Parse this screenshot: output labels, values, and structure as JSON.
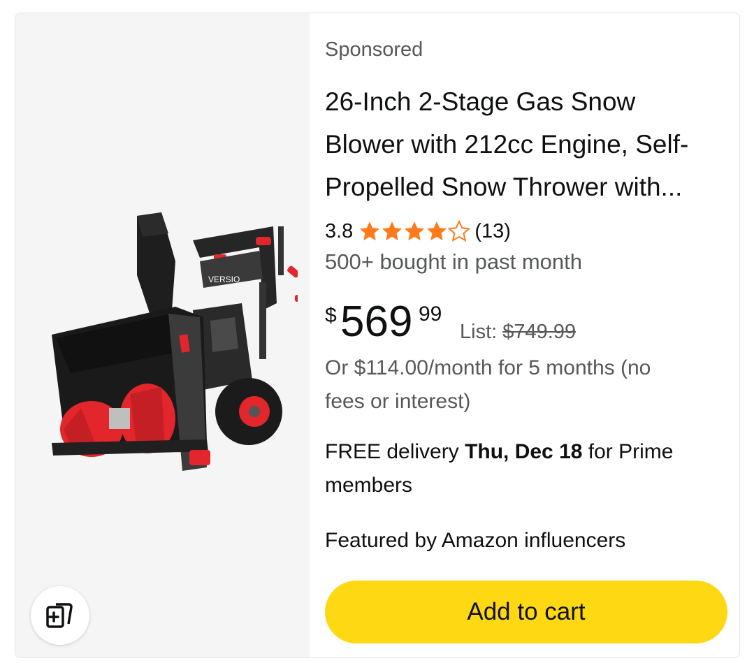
{
  "product": {
    "sponsored_label": "Sponsored",
    "title_line1": "26-Inch 2-Stage Gas Snow",
    "title_line2": "Blower with 212cc Engine, Self-",
    "title_line3": "Propelled Snow Thrower with...",
    "rating": "3.8",
    "rating_value": 3.8,
    "star_count": 5,
    "filled_stars": 4,
    "review_count": "(13)",
    "bought": "500+ bought in past month",
    "price_symbol": "$",
    "price_whole": "569",
    "price_fraction": "99",
    "list_label": "List: ",
    "list_price": "$749.99",
    "installment_line1": "Or $114.00/month for 5 months (no",
    "installment_line2": "fees or interest)",
    "delivery_prefix": "FREE delivery ",
    "delivery_date": "Thu, Dec 18",
    "delivery_suffix": " for Prime",
    "delivery_line2": "members",
    "featured": "Featured by Amazon influencers",
    "image_icon": "snow-blower-product-image",
    "image_brand_text": "VERSIO"
  },
  "actions": {
    "add_to_cart": "Add to cart",
    "compare_icon": "compare-cards-icon"
  },
  "colors": {
    "star": "#ff7a1a",
    "cart_button": "#ffd814",
    "image_panel": "#f5f5f5",
    "muted_text": "#565959",
    "accent_red": "#e3262b"
  }
}
